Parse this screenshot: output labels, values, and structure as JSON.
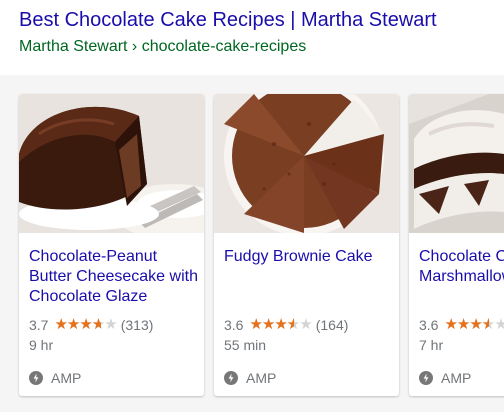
{
  "result": {
    "title": "Best Chocolate Cake Recipes | Martha Stewart",
    "url": "Martha Stewart › chocolate-cake-recipes"
  },
  "cards": [
    {
      "title": "Chocolate-Peanut Butter Cheesecake with Chocolate Glaze",
      "rating": "3.7",
      "rating_value": 3.7,
      "reviews": "(313)",
      "time": "9 hr",
      "amp": "AMP",
      "image_icon": "chocolate-cake-slice-image"
    },
    {
      "title": "Fudgy Brownie Cake",
      "rating": "3.6",
      "rating_value": 3.6,
      "reviews": "(164)",
      "time": "55 min",
      "amp": "AMP",
      "image_icon": "brownie-cake-image"
    },
    {
      "title": "Chocolate Cake with Marshmallow",
      "rating": "3.6",
      "rating_value": 3.6,
      "reviews": "",
      "time": "7 hr",
      "amp": "AMP",
      "image_icon": "marshmallow-cake-image"
    }
  ],
  "colors": {
    "link": "#1a0dab",
    "url": "#006621",
    "star": "#e7711b",
    "meta": "#70757a"
  }
}
